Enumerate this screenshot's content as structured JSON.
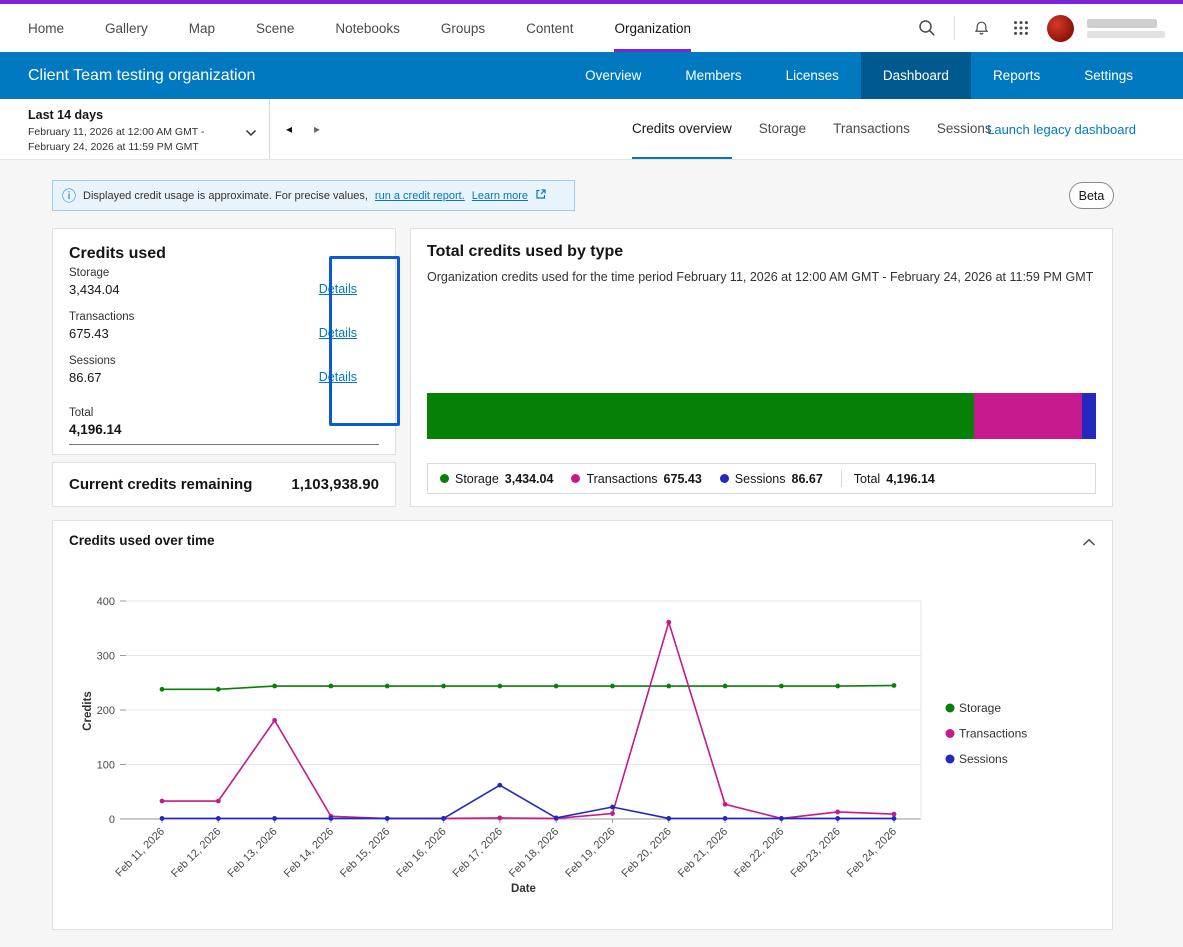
{
  "colors": {
    "purple": "#7d22dd",
    "blue": "#0079c1",
    "blue_dark": "#00598f",
    "focus": "#0a5ad0",
    "storage": "#068006",
    "transactions": "#c6198d",
    "sessions": "#2127bf"
  },
  "topnav": {
    "items": [
      "Home",
      "Gallery",
      "Map",
      "Scene",
      "Notebooks",
      "Groups",
      "Content",
      "Organization"
    ],
    "active": "Organization"
  },
  "org_header": {
    "title": "Client Team testing organization",
    "tabs": [
      "Overview",
      "Members",
      "Licenses",
      "Dashboard",
      "Reports",
      "Settings"
    ],
    "active_tab": "Dashboard"
  },
  "subheader": {
    "range_label": "Last 14 days",
    "range_dates": "February 11, 2026 at 12:00 AM GMT - February 24, 2026 at 11:59 PM GMT",
    "prev_glyph": "◂",
    "next_glyph": "▸",
    "tabs": [
      "Credits overview",
      "Storage",
      "Transactions",
      "Sessions"
    ],
    "active_tab": "Credits overview",
    "legacy_link": "Launch legacy dashboard"
  },
  "banner": {
    "text": "Displayed credit usage is approximate. For precise values,",
    "link1": "run a credit report.",
    "link2": "Learn more",
    "info_glyph": "ⓘ"
  },
  "beta_label": "Beta",
  "credits_used": {
    "title": "Credits used",
    "rows": [
      {
        "label": "Storage",
        "value": "3,434.04",
        "link": "Details"
      },
      {
        "label": "Transactions",
        "value": "675.43",
        "link": "Details"
      },
      {
        "label": "Sessions",
        "value": "86.67",
        "link": "Details"
      }
    ],
    "total_label": "Total",
    "total_value": "4,196.14"
  },
  "current_credits": {
    "label": "Current credits remaining",
    "value": "1,103,938.90"
  },
  "chart_data": [
    {
      "type": "bar",
      "variant": "horizontal-stacked",
      "title": "Total credits used by type",
      "subtitle": "Organization credits used for the time period February 11, 2026 at 12:00 AM GMT - February 24, 2026 at 11:59 PM GMT",
      "total": {
        "label": "Total",
        "value": 4196.14,
        "display": "4,196.14"
      },
      "segments": [
        {
          "label": "Storage",
          "value": 3434.04,
          "display": "3,434.04",
          "color": "#068006"
        },
        {
          "label": "Transactions",
          "value": 675.43,
          "display": "675.43",
          "color": "#c6198d"
        },
        {
          "label": "Sessions",
          "value": 86.67,
          "display": "86.67",
          "color": "#2127bf"
        }
      ]
    },
    {
      "type": "line",
      "title": "Credits used over time",
      "xlabel": "Date",
      "ylabel": "Credits",
      "ylim": [
        0,
        400
      ],
      "yticks": [
        0,
        100,
        200,
        300,
        400
      ],
      "grid": true,
      "legend_position": "right",
      "categories": [
        "Feb 11, 2026",
        "Feb 12, 2026",
        "Feb 13, 2026",
        "Feb 14, 2026",
        "Feb 15, 2026",
        "Feb 16, 2026",
        "Feb 17, 2026",
        "Feb 18, 2026",
        "Feb 19, 2026",
        "Feb 20, 2026",
        "Feb 21, 2026",
        "Feb 22, 2026",
        "Feb 23, 2026",
        "Feb 24, 2026"
      ],
      "series": [
        {
          "name": "Storage",
          "color": "#068006",
          "values": [
            238,
            238,
            244,
            244,
            244,
            244,
            244,
            244,
            244,
            244,
            244,
            244,
            244,
            245
          ]
        },
        {
          "name": "Transactions",
          "color": "#c6198d",
          "values": [
            33,
            33,
            181,
            5,
            1,
            1,
            2,
            1,
            10,
            361,
            27,
            1,
            13,
            9
          ]
        },
        {
          "name": "Sessions",
          "color": "#2127bf",
          "values": [
            1,
            1,
            1,
            1,
            1,
            1,
            62,
            2,
            22,
            1,
            1,
            1,
            1,
            1
          ]
        }
      ]
    }
  ]
}
